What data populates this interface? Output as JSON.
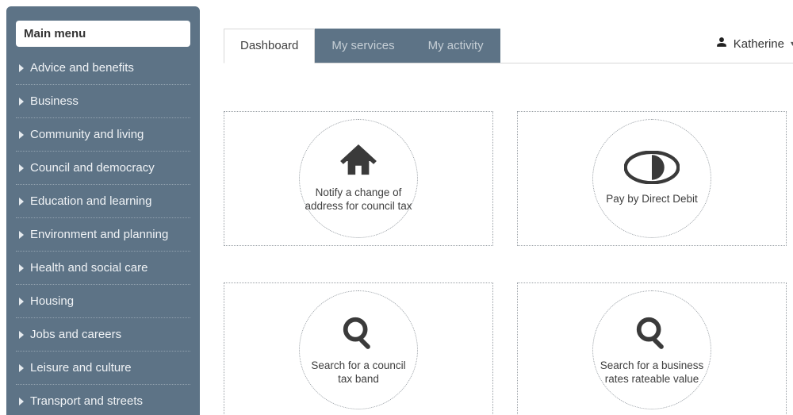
{
  "sidebar": {
    "title": "Main menu",
    "items": [
      {
        "label": "Advice and benefits"
      },
      {
        "label": "Business"
      },
      {
        "label": "Community and living"
      },
      {
        "label": "Council and democracy"
      },
      {
        "label": "Education and learning"
      },
      {
        "label": "Environment and planning"
      },
      {
        "label": "Health and social care"
      },
      {
        "label": "Housing"
      },
      {
        "label": "Jobs and careers"
      },
      {
        "label": "Leisure and culture"
      },
      {
        "label": "Transport and streets"
      }
    ]
  },
  "tabs": {
    "dashboard": "Dashboard",
    "my_services": "My services",
    "my_activity": "My activity"
  },
  "user": {
    "name": "Katherine"
  },
  "tiles": {
    "t0": {
      "label": "Notify a change of address for council tax",
      "icon": "house-icon"
    },
    "t1": {
      "label": "Pay by Direct Debit",
      "icon": "direct-debit-icon"
    },
    "t2": {
      "label": "Search for a council tax band",
      "icon": "search-icon"
    },
    "t3": {
      "label": "Search for a business rates rateable value",
      "icon": "search-icon"
    }
  }
}
